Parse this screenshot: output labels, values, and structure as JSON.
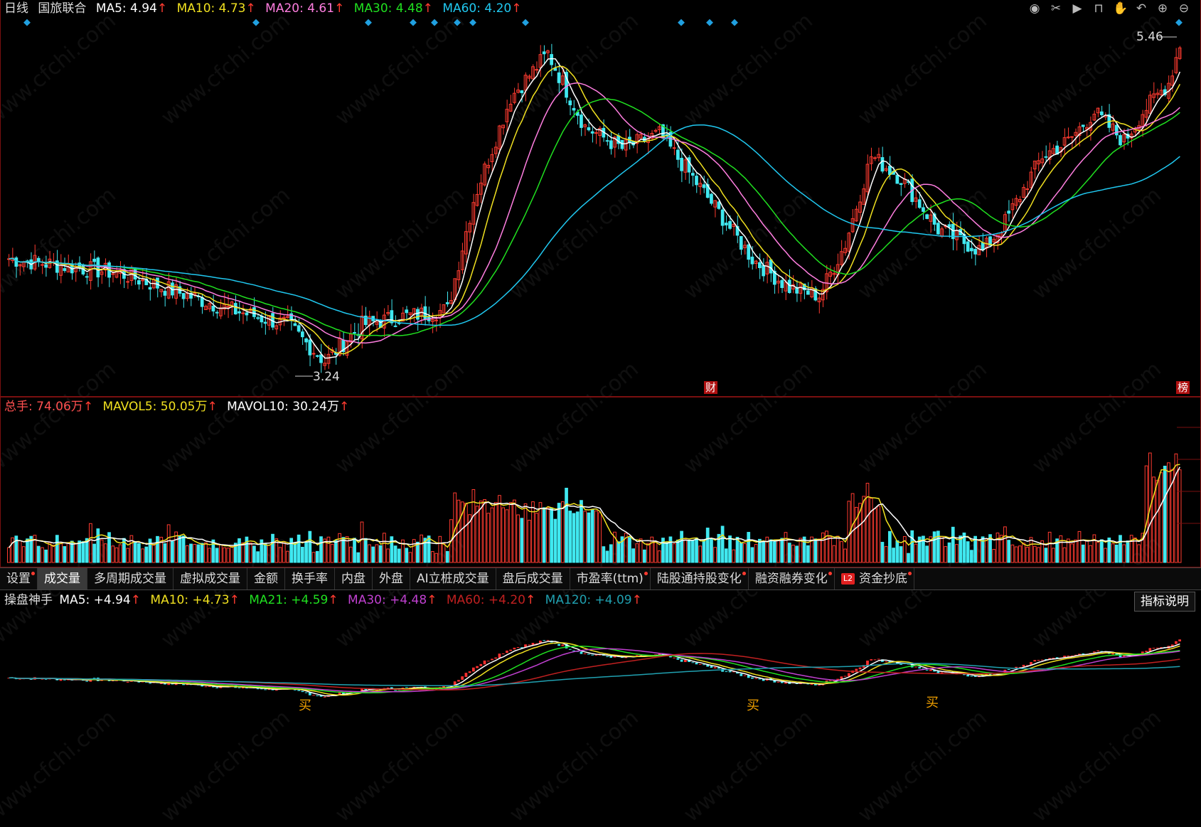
{
  "main_legend": {
    "period": "日线",
    "stock_name": "国旅联合",
    "ma5": "MA5: 4.94",
    "ma10": "MA10: 4.73",
    "ma20": "MA20: 4.61",
    "ma30": "MA30: 4.48",
    "ma60": "MA60: 4.20",
    "arrow": "↑"
  },
  "main_chart": {
    "high_label": "5.46",
    "low_label": "3.24",
    "marker_cai": "财",
    "marker_bang": "榜"
  },
  "volume_legend": {
    "total": "总手: 74.06万",
    "mavol5": "MAVOL5: 50.05万",
    "mavol10": "MAVOL10: 30.24万",
    "arrow": "↑"
  },
  "tabs": [
    {
      "label": "设置",
      "dot": true
    },
    {
      "label": "成交量",
      "active": true
    },
    {
      "label": "多周期成交量"
    },
    {
      "label": "虚拟成交量"
    },
    {
      "label": "金额"
    },
    {
      "label": "换手率"
    },
    {
      "label": "内盘"
    },
    {
      "label": "外盘"
    },
    {
      "label": "AI立桩成交量"
    },
    {
      "label": "盘后成交量"
    },
    {
      "label": "市盈率(ttm)",
      "dot": true
    },
    {
      "label": "陆股通持股变化",
      "dot": true
    },
    {
      "label": "融资融券变化",
      "dot": true
    },
    {
      "label": "资金抄底",
      "dot": true,
      "badge": "L2"
    }
  ],
  "indicator_legend": {
    "name": "操盘神手",
    "ma5": "MA5: +4.94",
    "ma10": "MA10: +4.73",
    "ma21": "MA21: +4.59",
    "ma30": "MA30: +4.48",
    "ma60": "MA60: +4.20",
    "ma120": "MA120: +4.09",
    "arrow": "↑"
  },
  "explain_button": "指标说明",
  "buy_signals": [
    "买",
    "买",
    "买"
  ],
  "watermark": "www.cfchi.com",
  "toolbar_icons": [
    "eye-icon",
    "scissors-icon",
    "play-icon",
    "lock-icon",
    "hand-icon",
    "undo-icon",
    "zoom-in-icon",
    "zoom-out-icon"
  ],
  "colors": {
    "ma5": "#ffffff",
    "ma10": "#f0e020",
    "ma20": "#ff7ee0",
    "ma30": "#20e020",
    "ma60": "#20c8f0",
    "up": "#ff3b30",
    "down": "#40e8f0"
  },
  "chart_data": {
    "type": "candlestick",
    "price_range": [
      3.24,
      5.46
    ]
  }
}
